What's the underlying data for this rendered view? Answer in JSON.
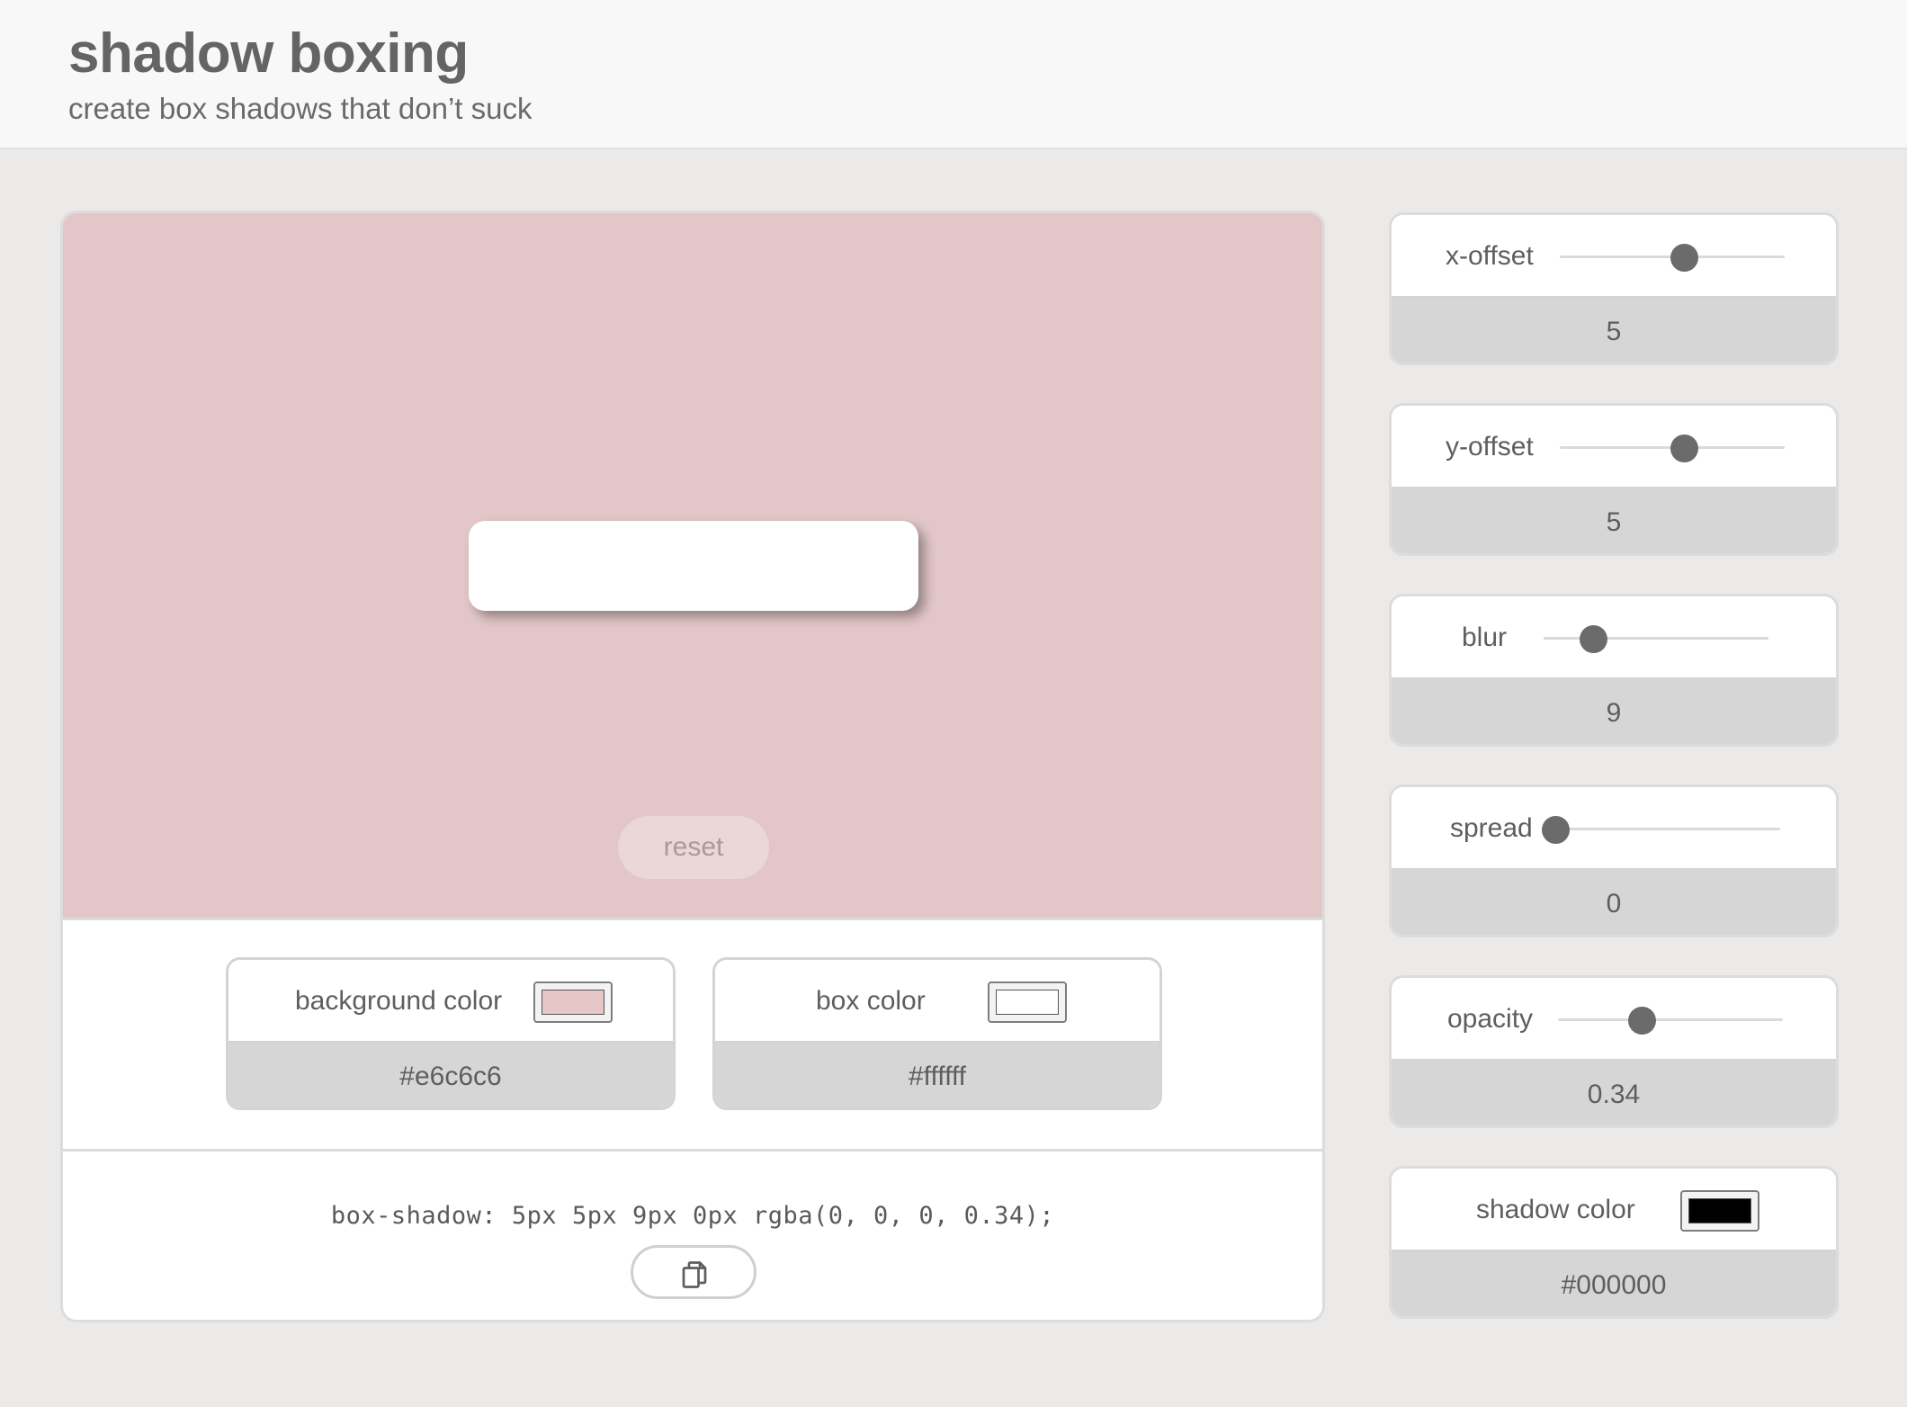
{
  "header": {
    "title": "shadow boxing",
    "subtitle": "create box shadows that don’t suck"
  },
  "preview": {
    "background_color": "#e2c6c8",
    "box_color": "#ffffff",
    "reset_label": "reset"
  },
  "colors": {
    "background": {
      "label": "background color",
      "value": "#e6c6c6",
      "swatch": "#e6c6c6"
    },
    "box": {
      "label": "box color",
      "value": "#ffffff",
      "swatch": "#ffffff"
    }
  },
  "output": {
    "css": "box-shadow: 5px 5px 9px 0px rgba(0, 0, 0, 0.34);",
    "copy_icon": "copy-icon"
  },
  "controls": {
    "x_offset": {
      "label": "x-offset",
      "value": "5",
      "level": 0.55
    },
    "y_offset": {
      "label": "y-offset",
      "value": "5",
      "level": 0.55
    },
    "blur": {
      "label": "blur",
      "value": "9",
      "level": 0.22
    },
    "spread": {
      "label": "spread",
      "value": "0",
      "level": 0.0
    },
    "opacity": {
      "label": "opacity",
      "value": "0.34",
      "level": 0.37
    },
    "shadow_color": {
      "label": "shadow color",
      "value": "#000000",
      "swatch": "#000000"
    }
  },
  "accent": {
    "thumb": "#6b6b6b",
    "card_footer": "#d6d6d6"
  }
}
